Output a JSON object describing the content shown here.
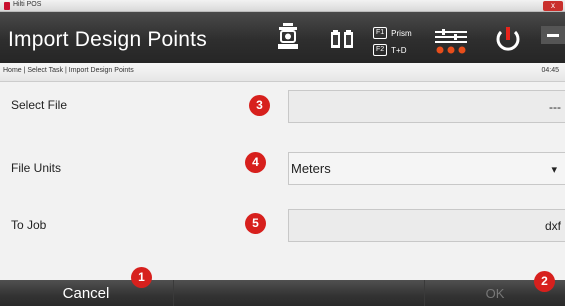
{
  "window": {
    "title": "Hilti POS",
    "close_label": "x"
  },
  "header": {
    "title": "Import Design Points",
    "f1_key": "F1",
    "f1_label": "Prism",
    "f2_key": "F2",
    "f2_label": "T+D"
  },
  "breadcrumb": {
    "text": "Home | Select Task | Import Design Points",
    "time": "04:45"
  },
  "form": {
    "select_file": {
      "label": "Select File",
      "value": "---",
      "callout": "3"
    },
    "file_units": {
      "label": "File Units",
      "value": "Meters",
      "callout": "4"
    },
    "to_job": {
      "label": "To Job",
      "value": "dxf",
      "callout": "5"
    }
  },
  "footer": {
    "cancel_label": "Cancel",
    "cancel_callout": "1",
    "ok_label": "OK",
    "ok_callout": "2"
  },
  "colors": {
    "accent_red": "#d7201d",
    "header_bg": "#2e2e2e",
    "body_bg": "#f2f2f2"
  }
}
